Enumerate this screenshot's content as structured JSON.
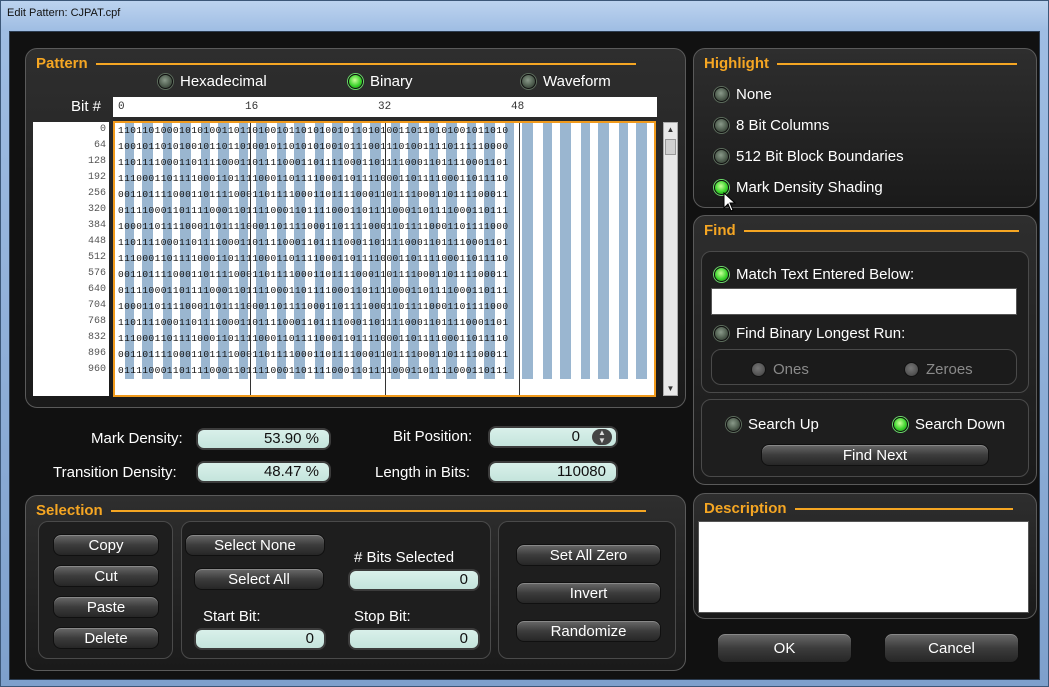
{
  "window": {
    "title": "Edit Pattern: CJPAT.cpf"
  },
  "pattern": {
    "title": "Pattern",
    "modes": [
      {
        "label": "Hexadecimal",
        "selected": false
      },
      {
        "label": "Binary",
        "selected": true
      },
      {
        "label": "Waveform",
        "selected": false
      }
    ],
    "bit_label": "Bit #",
    "ruler": [
      "0",
      "16",
      "32",
      "48"
    ],
    "row_offsets": [
      "0",
      "64",
      "128",
      "192",
      "256",
      "320",
      "384",
      "448",
      "512",
      "576",
      "640",
      "704",
      "768",
      "832",
      "896",
      "960"
    ],
    "rows": [
      "1101101000101010011011010010110101001011010100110110101001011010",
      "1001011010100101101101001011010101001011100111010011110111110000",
      "1101111000110111100011011110001101111000110111100011011110001101",
      "1110001101111000110111100011011110001101111000110111100011011110",
      "0011011110001101111000110111100011011110001101111000110111100011",
      "0111100011011110001101111000110111100011011110001101111000110111",
      "1000110111100011011110001101111000110111100011011110001101111000",
      "1101111000110111100011011110001101111000110111100011011110001101",
      "1110001101111000110111100011011110001101111000110111100011011110",
      "0011011110001101111000110111100011011110001101111000110111100011",
      "0111100011011110001101111000110111100011011110001101111000110111",
      "1000110111100011011110001101111000110111100011011110001101111000",
      "1101111000110111100011011110001101111000110111100011011110001101",
      "1110001101111000110111100011011110001101111000110111100011011110",
      "0011011110001101111000110111100011011110001101111000110111100011",
      "0111100011011110001101111000110111100011011110001101111000110111"
    ]
  },
  "stats": {
    "mark_density_label": "Mark Density:",
    "mark_density": "53.90 %",
    "transition_density_label": "Transition Density:",
    "transition_density": "48.47 %",
    "bit_position_label": "Bit Position:",
    "bit_position": "0",
    "length_label": "Length in Bits:",
    "length": "110080"
  },
  "selection": {
    "title": "Selection",
    "copy": "Copy",
    "cut": "Cut",
    "paste": "Paste",
    "delete": "Delete",
    "select_none": "Select None",
    "select_all": "Select All",
    "bits_selected_label": "# Bits Selected",
    "bits_selected": "0",
    "start_label": "Start Bit:",
    "start": "0",
    "stop_label": "Stop Bit:",
    "stop": "0",
    "set_all_zero": "Set All Zero",
    "invert": "Invert",
    "randomize": "Randomize"
  },
  "highlight": {
    "title": "Highlight",
    "options": [
      {
        "label": "None",
        "selected": false
      },
      {
        "label": "8 Bit Columns",
        "selected": false
      },
      {
        "label": "512 Bit Block Boundaries",
        "selected": false
      },
      {
        "label": "Mark Density Shading",
        "selected": true
      }
    ]
  },
  "find": {
    "title": "Find",
    "match_text_label": "Match Text Entered Below:",
    "match_text_value": "",
    "longest_run_label": "Find Binary Longest Run:",
    "ones": "Ones",
    "zeroes": "Zeroes",
    "search_up": "Search Up",
    "search_down": "Search Down",
    "find_next": "Find Next"
  },
  "description": {
    "title": "Description",
    "text": ""
  },
  "footer": {
    "ok": "OK",
    "cancel": "Cancel"
  }
}
